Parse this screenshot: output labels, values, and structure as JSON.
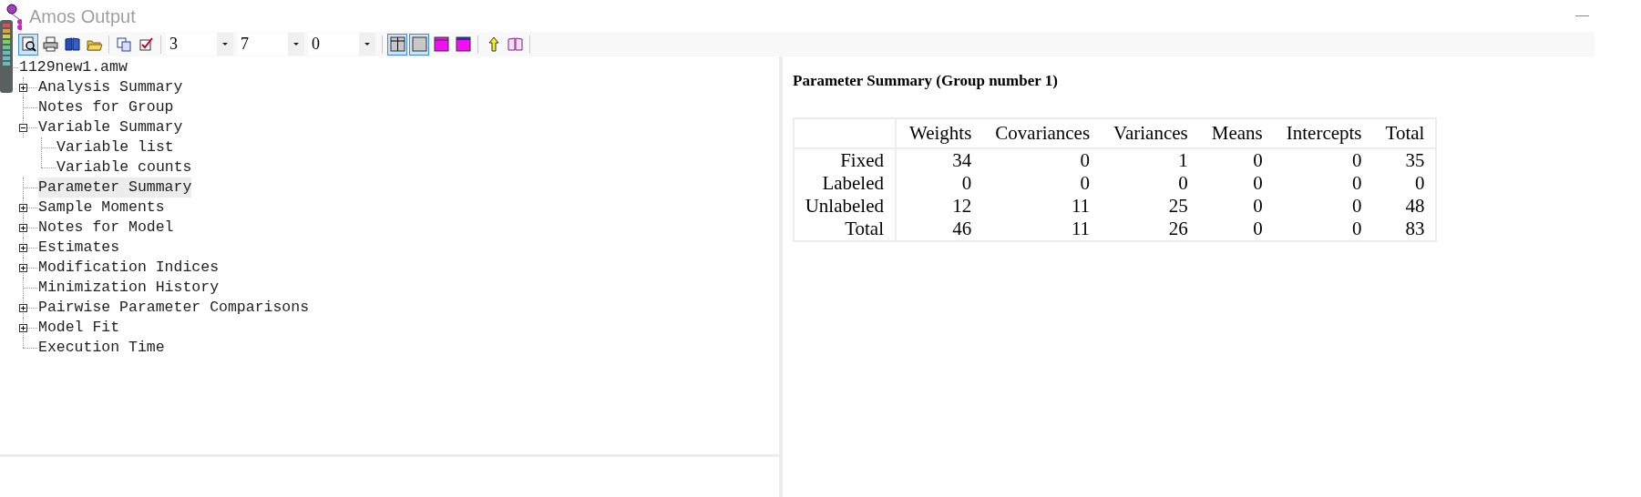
{
  "window": {
    "title": "Amos Output"
  },
  "toolbar": {
    "items": [
      {
        "kind": "button",
        "pressed": true
      },
      {
        "kind": "button",
        "pressed": false
      },
      {
        "kind": "button",
        "pressed": false
      },
      {
        "kind": "button",
        "pressed": false
      },
      {
        "kind": "separator"
      },
      {
        "kind": "button",
        "pressed": false
      },
      {
        "kind": "button",
        "pressed": false
      },
      {
        "kind": "separator"
      },
      {
        "kind": "combo",
        "value": "3"
      },
      {
        "kind": "combo",
        "value": "7"
      },
      {
        "kind": "combo",
        "value": "0"
      },
      {
        "kind": "separator"
      },
      {
        "kind": "button",
        "pressed": true
      },
      {
        "kind": "button",
        "pressed": true
      },
      {
        "kind": "button",
        "pressed": false
      },
      {
        "kind": "button",
        "pressed": false
      },
      {
        "kind": "separator"
      },
      {
        "kind": "button",
        "pressed": false
      },
      {
        "kind": "button",
        "pressed": false
      },
      {
        "kind": "separator"
      }
    ]
  },
  "tree": {
    "label": "1129new1.amw",
    "selected": false,
    "children": [
      {
        "label": "Analysis Summary",
        "expanded": false,
        "selected": false
      },
      {
        "label": "Notes for Group",
        "selected": false
      },
      {
        "label": "Variable Summary",
        "expanded": true,
        "selected": false,
        "children": [
          {
            "label": "Variable list",
            "selected": false
          },
          {
            "label": "Variable counts",
            "selected": false
          }
        ]
      },
      {
        "label": "Parameter Summary",
        "selected": true
      },
      {
        "label": "Sample Moments",
        "expanded": false,
        "selected": false
      },
      {
        "label": "Notes for Model",
        "expanded": false,
        "selected": false
      },
      {
        "label": "Estimates",
        "expanded": false,
        "selected": false
      },
      {
        "label": "Modification Indices",
        "expanded": false,
        "selected": false
      },
      {
        "label": "Minimization History",
        "selected": false
      },
      {
        "label": "Pairwise Parameter Comparisons",
        "expanded": false,
        "selected": false
      },
      {
        "label": "Model Fit",
        "expanded": false,
        "selected": false
      },
      {
        "label": "Execution Time",
        "selected": false
      }
    ]
  },
  "report": {
    "heading": "Parameter Summary (Group number 1)",
    "table": {
      "columns": [
        "Weights",
        "Covariances",
        "Variances",
        "Means",
        "Intercepts",
        "Total"
      ],
      "rows": [
        {
          "label": "Fixed",
          "cells": [
            "34",
            "0",
            "1",
            "0",
            "0",
            "35"
          ]
        },
        {
          "label": "Labeled",
          "cells": [
            "0",
            "0",
            "0",
            "0",
            "0",
            "0"
          ]
        },
        {
          "label": "Unlabeled",
          "cells": [
            "12",
            "11",
            "25",
            "0",
            "0",
            "48"
          ]
        },
        {
          "label": "Total",
          "cells": [
            "46",
            "11",
            "26",
            "0",
            "0",
            "83"
          ]
        }
      ]
    }
  }
}
